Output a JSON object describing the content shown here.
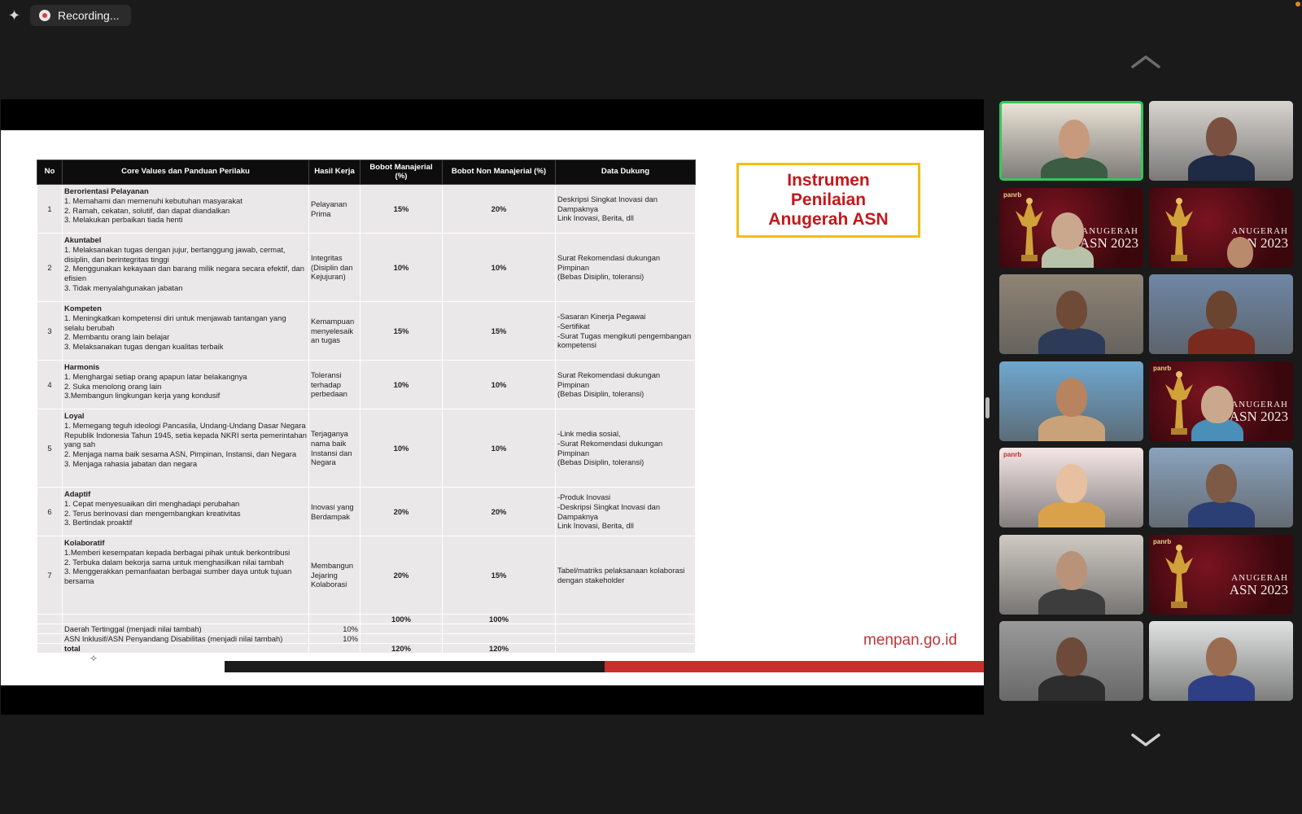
{
  "app": {
    "recording_label": "Recording...",
    "colors": {
      "speaking": "#34c759",
      "title_red": "#c4181b",
      "title_border": "#f1bf12",
      "site_red": "#c43438"
    }
  },
  "slide": {
    "headers": [
      "No",
      "Core Values dan Panduan Perilaku",
      "Hasil Kerja",
      "Bobot Manajerial (%)",
      "Bobot Non Manajerial (%)",
      "Data Dukung"
    ],
    "rows": [
      {
        "no": "1",
        "title": "Berorientasi Pelayanan",
        "lines": [
          "1. Memahami dan memenuhi kebutuhan masyarakat",
          "2. Ramah, cekatan, solutif, dan dapat diandalkan",
          "3. Melakukan perbaikan tiada henti"
        ],
        "hasil": "Pelayanan Prima",
        "manajerial": "15%",
        "non_manajerial": "20%",
        "data_dukung": [
          "Deskripsi Singkat Inovasi dan Dampaknya",
          "Link Inovasi, Berita, dll"
        ]
      },
      {
        "no": "2",
        "title": "Akuntabel",
        "lines": [
          "1. Melaksanakan tugas dengan jujur, bertanggung jawab, cermat, disiplin, dan berintegritas tinggi",
          "2. Menggunakan kekayaan dan barang milik negara secara efektif, dan efisien",
          "3. Tidak menyalahgunakan jabatan"
        ],
        "hasil": "Integritas (Disiplin dan Kejujuran)",
        "manajerial": "10%",
        "non_manajerial": "10%",
        "data_dukung": [
          "Surat Rekomendasi dukungan Pimpinan",
          "(Bebas Disiplin, toleransi)"
        ]
      },
      {
        "no": "3",
        "title": "Kompeten",
        "lines": [
          "1. Meningkatkan kompetensi diri untuk menjawab tantangan yang selalu berubah",
          "2. Membantu orang lain belajar",
          "3. Melaksanakan tugas dengan kualitas terbaik"
        ],
        "hasil": "Kemampuan menyelesaik an tugas",
        "manajerial": "15%",
        "non_manajerial": "15%",
        "data_dukung": [
          "-Sasaran Kinerja Pegawai",
          "-Sertifikat",
          "-Surat Tugas mengikuti pengembangan kompetensi"
        ]
      },
      {
        "no": "4",
        "title": "Harmonis",
        "lines": [
          "1. Menghargai setiap orang apapun latar belakangnya",
          "2. Suka menolong orang lain",
          "3.Membangun lingkungan kerja yang kondusif"
        ],
        "hasil": "Toleransi terhadap perbedaan",
        "manajerial": "10%",
        "non_manajerial": "10%",
        "data_dukung": [
          "Surat Rekomendasi dukungan Pimpinan",
          "(Bebas Disiplin, toleransi)"
        ]
      },
      {
        "no": "5",
        "title": "Loyal",
        "lines": [
          "1. Memegang teguh ideologi Pancasila, Undang-Undang Dasar Negara Republik Indonesia Tahun 1945, setia kepada NKRI serta pemerintahan yang sah",
          "2. Menjaga nama baik sesama ASN, Pimpinan, Instansi, dan Negara",
          "3. Menjaga rahasia jabatan dan negara"
        ],
        "hasil": "Terjaganya nama baik Instansi dan Negara",
        "manajerial": "10%",
        "non_manajerial": "10%",
        "data_dukung": [
          "-Link media sosial,",
          "-Surat Rekomendasi dukungan Pimpinan",
          "(Bebas Disiplin, toleransi)"
        ]
      },
      {
        "no": "6",
        "title": "Adaptif",
        "lines": [
          "1. Cepat menyesuaikan diri menghadapi perubahan",
          "2. Terus berinovasi dan mengembangkan kreativitas",
          "3. Bertindak proaktif"
        ],
        "hasil": "Inovasi yang Berdampak",
        "manajerial": "20%",
        "non_manajerial": "20%",
        "data_dukung": [
          "-Produk Inovasi",
          "-Deskripsi Singkat Inovasi dan Dampaknya",
          "Link Inovasi, Berita, dll"
        ]
      },
      {
        "no": "7",
        "title": "Kolaboratif",
        "lines": [
          "1.Memberi kesempatan kepada berbagai pihak untuk berkontribusi",
          "2. Terbuka dalam bekorja sama untuk menghasilkan nilai tambah",
          "3. Menggerakkan pemanfaatan berbagai sumber daya untuk tujuan bersama"
        ],
        "hasil": "Membangun Jejaring Kolaborasi",
        "manajerial": "20%",
        "non_manajerial": "15%",
        "data_dukung": [
          "Tabel/matriks pelaksanaan kolaborasi dengan stakeholder"
        ]
      }
    ],
    "subtotal": {
      "manajerial": "100%",
      "non_manajerial": "100%"
    },
    "extra1": {
      "label": "Daerah Tertinggal (menjadi nilai tambah)",
      "value": "10%"
    },
    "extra2": {
      "label": "ASN Inklusif/ASN Penyandang Disabilitas (menjadi nilai tambah)",
      "value": "10%"
    },
    "total": {
      "label": "total",
      "manajerial": "120%",
      "non_manajerial": "120%"
    },
    "title_lines": [
      "Instrumen",
      "Penilaian",
      "Anugerah ASN"
    ],
    "site": "menpan.go.id"
  },
  "gallery": {
    "tiles": [
      {
        "kind": "person",
        "speaking": true
      },
      {
        "kind": "person"
      },
      {
        "kind": "anugerah",
        "logo": "panrb",
        "text1": "ANUGERAH",
        "text2": "ASN 2023"
      },
      {
        "kind": "anugerah",
        "text1": "ANUGERAH",
        "text2": "ASN 2023"
      },
      {
        "kind": "office"
      },
      {
        "kind": "person"
      },
      {
        "kind": "person"
      },
      {
        "kind": "anugerah",
        "logo": "panrb",
        "text1": "ANUGERAH",
        "text2": "ASN 2023"
      },
      {
        "kind": "panrb-bg",
        "logo": "panrb"
      },
      {
        "kind": "person"
      },
      {
        "kind": "office"
      },
      {
        "kind": "anugerah",
        "logo": "panrb",
        "text1": "ANUGERAH",
        "text2": "ASN 2023"
      },
      {
        "kind": "person"
      },
      {
        "kind": "person"
      }
    ]
  }
}
